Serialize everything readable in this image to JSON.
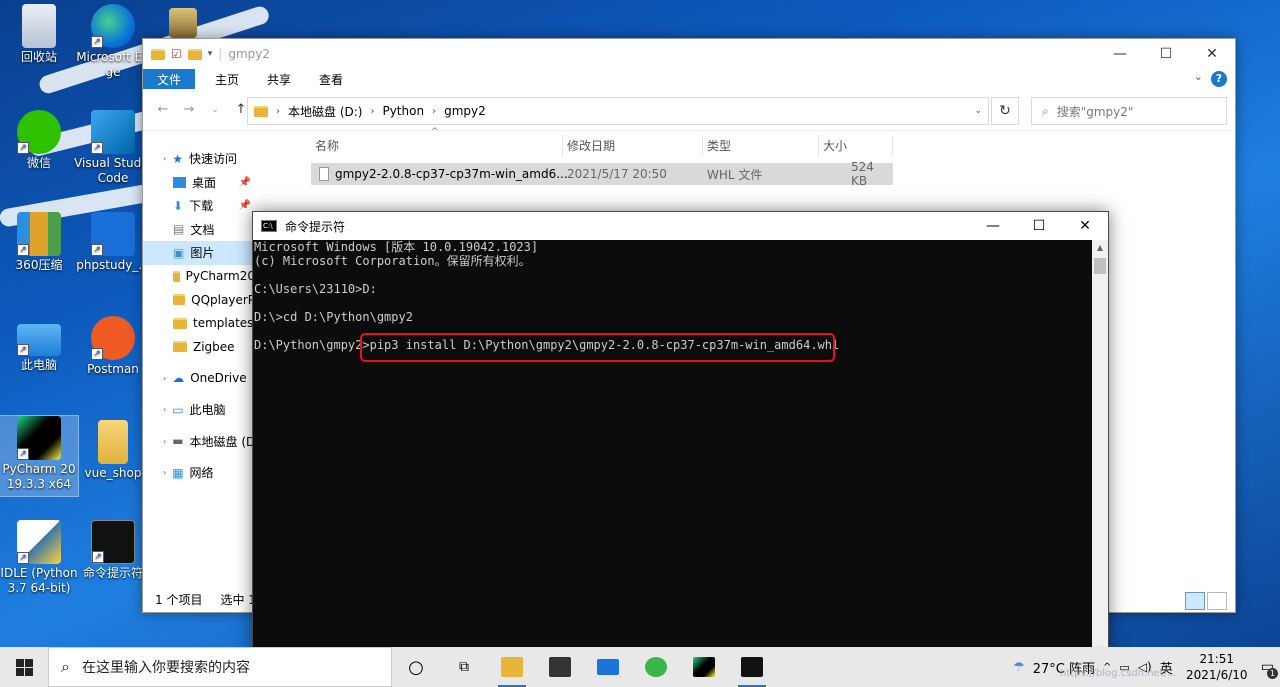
{
  "desktop": {
    "icons": [
      {
        "label": "回收站"
      },
      {
        "label": "Microsoft Edge"
      },
      {
        "label": "微信"
      },
      {
        "label": "Visual Studio Code"
      },
      {
        "label": "360压缩"
      },
      {
        "label": "phpstudy_..."
      },
      {
        "label": "此电脑"
      },
      {
        "label": "Postman"
      },
      {
        "label": "PyCharm 2019.3.3 x64"
      },
      {
        "label": "vue_shop"
      },
      {
        "label": "IDLE (Python 3.7 64-bit)"
      },
      {
        "label": "命令提示符"
      }
    ]
  },
  "explorer": {
    "title": "gmpy2",
    "ribbon": {
      "file": "文件",
      "home": "主页",
      "share": "共享",
      "view": "查看"
    },
    "address": {
      "crumbs": [
        "本地磁盘 (D:)",
        "Python",
        "gmpy2"
      ]
    },
    "search_placeholder": "搜索\"gmpy2\"",
    "nav": {
      "quick_access": "快速访问",
      "items": [
        "桌面",
        "下载",
        "文档",
        "图片",
        "PyCharm20",
        "QQplayerP",
        "templates",
        "Zigbee"
      ],
      "onedrive": "OneDrive",
      "this_pc": "此电脑",
      "local_disk": "本地磁盘 (D:",
      "network": "网络"
    },
    "columns": {
      "name": "名称",
      "date": "修改日期",
      "type": "类型",
      "size": "大小"
    },
    "files": [
      {
        "name": "gmpy2-2.0.8-cp37-cp37m-win_amd6...",
        "date": "2021/5/17 20:50",
        "type": "WHL 文件",
        "size": "524 KB"
      }
    ],
    "status": {
      "count": "1 个项目",
      "selected": "选中 1"
    }
  },
  "cmd": {
    "title": "命令提示符",
    "lines": [
      "Microsoft Windows [版本 10.0.19042.1023]",
      "(c) Microsoft Corporation。保留所有权利。",
      "",
      "C:\\Users\\23110>D:",
      "",
      "D:\\>cd D:\\Python\\gmpy2",
      "",
      "D:\\Python\\gmpy2>pip3 install D:\\Python\\gmpy2\\gmpy2-2.0.8-cp37-cp37m-win_amd64.whl"
    ],
    "highlight_color": "#e81123"
  },
  "taskbar": {
    "search_placeholder": "在这里输入你要搜索的内容",
    "weather": "27°C 阵雨",
    "ime": "英",
    "time": "21:51",
    "date": "2021/6/10",
    "notification_badge": "1"
  },
  "watermark": "https://blog.csdn.net/..."
}
